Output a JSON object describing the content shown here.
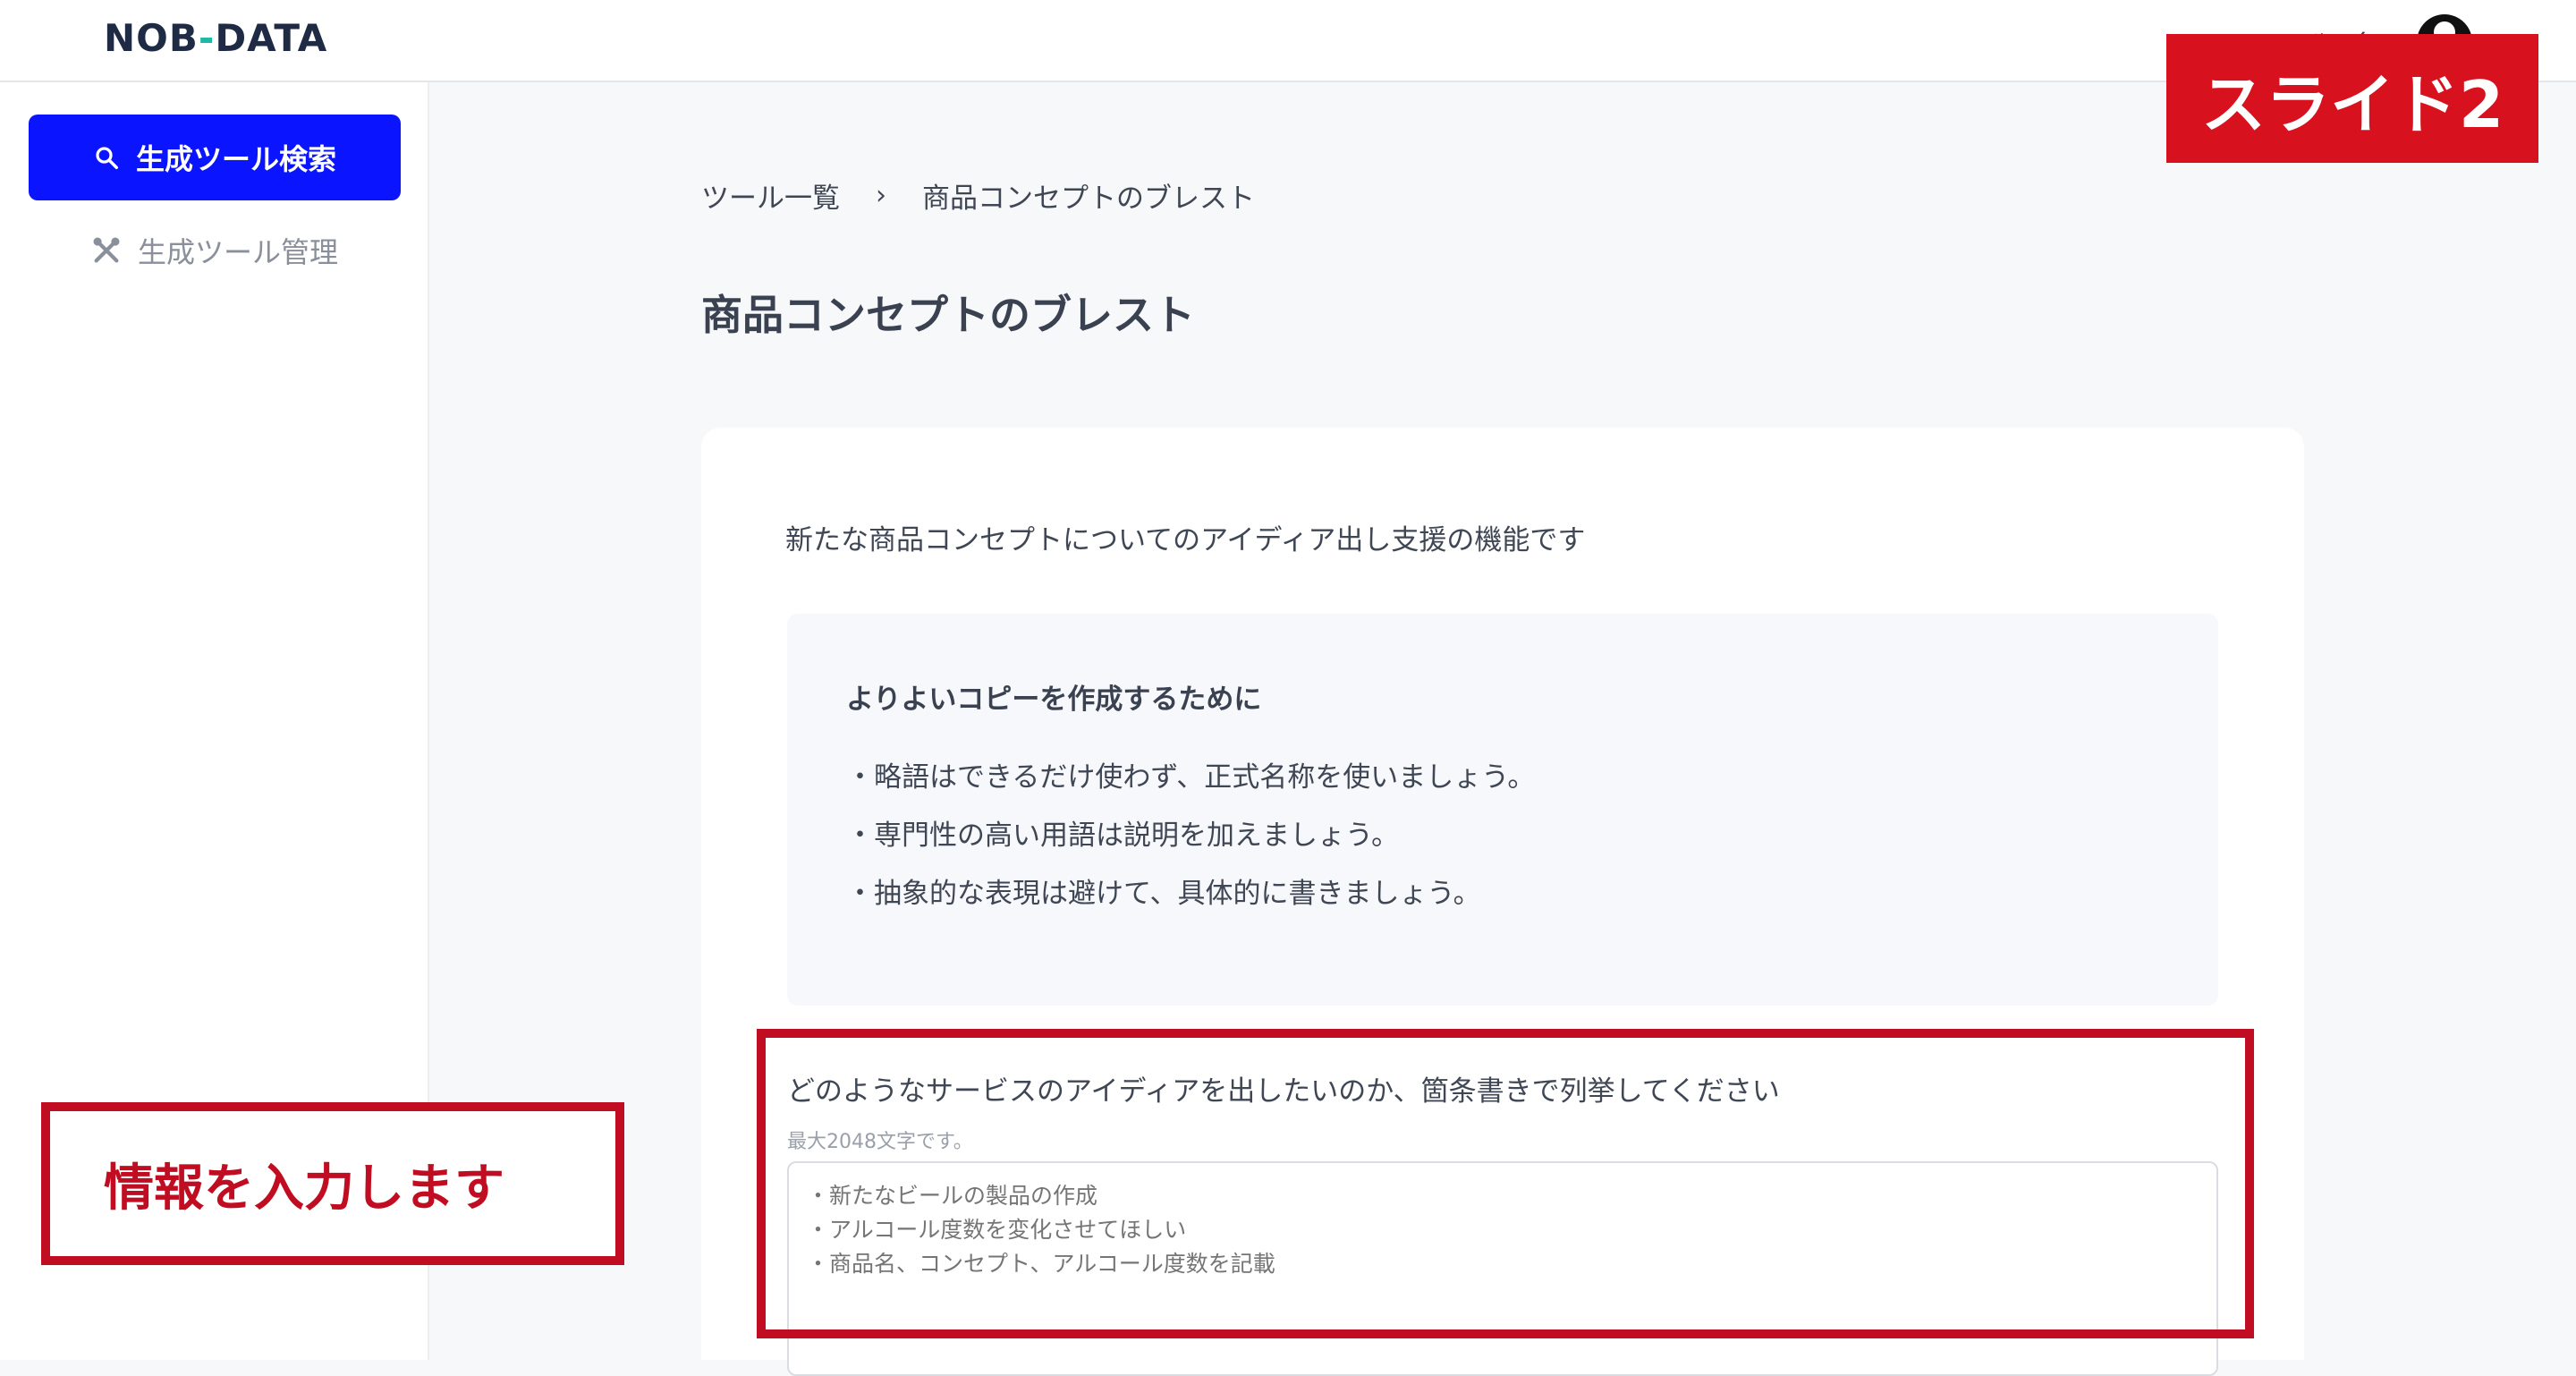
{
  "header": {
    "logo_left": "NOB",
    "logo_dash": "-",
    "logo_right": "DATA",
    "user_name": "ユーザー名",
    "avatar_icon": "user-avatar-icon"
  },
  "sidebar": {
    "items": [
      {
        "label": "生成ツール検索",
        "icon": "search-icon",
        "active": true
      },
      {
        "label": "生成ツール管理",
        "icon": "tools-icon",
        "active": false
      }
    ]
  },
  "breadcrumb": {
    "parent": "ツール一覧",
    "separator": "›",
    "current": "商品コンセプトのブレスト"
  },
  "page": {
    "title": "商品コンセプトのブレスト",
    "description": "新たな商品コンセプトについてのアイディア出し支援の機能です"
  },
  "tips": {
    "title": "よりよいコピーを作成するために",
    "items": [
      "・略語はできるだけ使わず、正式名称を使いましょう。",
      "・専門性の高い用語は説明を加えましょう。",
      "・抽象的な表現は避けて、具体的に書きましょう。"
    ]
  },
  "form": {
    "label": "どのようなサービスのアイディアを出したいのか、箇条書きで列挙してください",
    "hint": "最大2048文字です。",
    "placeholder": "・新たなビールの製品の作成\n・アルコール度数を変化させてほしい\n・商品名、コンセプト、アルコール度数を記載"
  },
  "annotations": {
    "slide_label": "スライド2",
    "note": "情報を入力します"
  },
  "colors": {
    "primary": "#0a14ff",
    "annotation_red": "#c10d22",
    "badge_red": "#d7111e",
    "logo_accent": "#1fb7a6"
  }
}
